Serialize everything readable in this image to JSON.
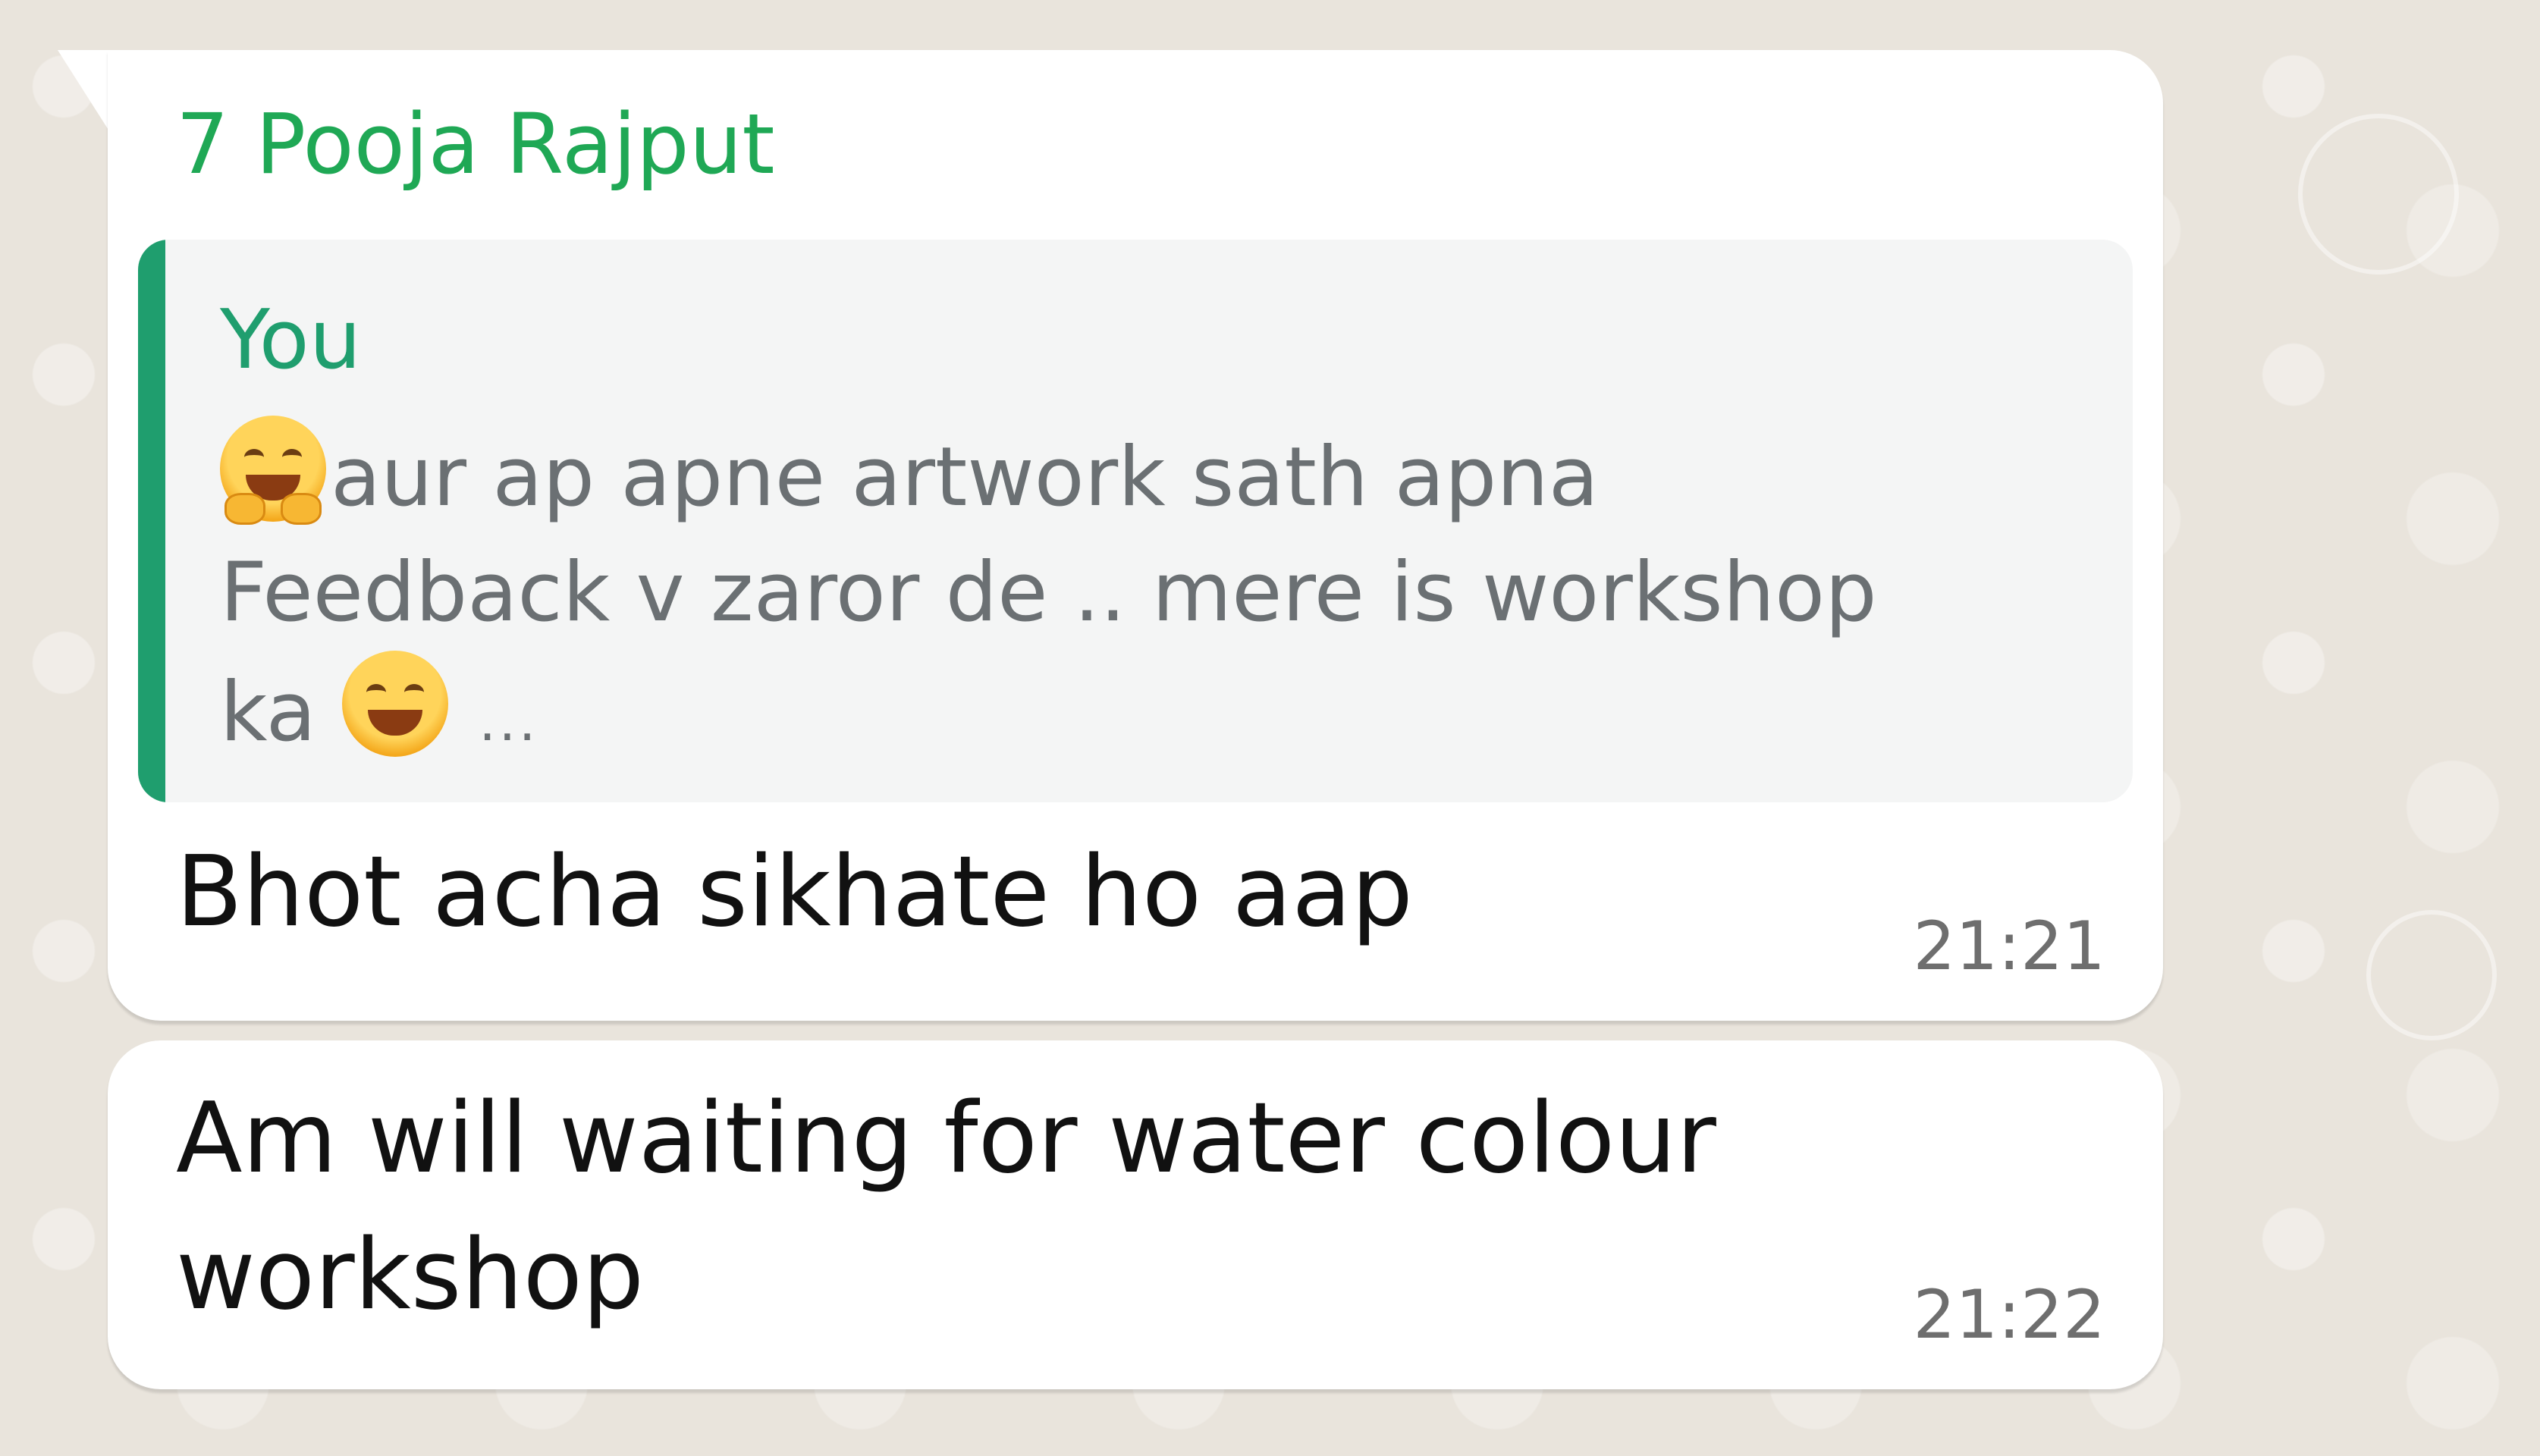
{
  "messages": [
    {
      "sender": "7 Pooja Rajput",
      "quoted": {
        "author": "You",
        "text_line1": "aur ap apne artwork sath apna",
        "text_line2": "Feedback v zaror de .. mere is workshop",
        "text_line3": "ka",
        "trail": "...",
        "emojis": [
          "hugging-face-emoji",
          "grinning-squinting-face-emoji"
        ]
      },
      "text": "Bhot acha sikhate ho aap",
      "time": "21:21"
    },
    {
      "text": "Am will  waiting for water colour workshop",
      "time": "21:22"
    }
  ],
  "colors": {
    "sender": "#1fa855",
    "quote_accent": "#1f9e6e",
    "bubble": "#ffffff",
    "background": "#ece5dd"
  }
}
